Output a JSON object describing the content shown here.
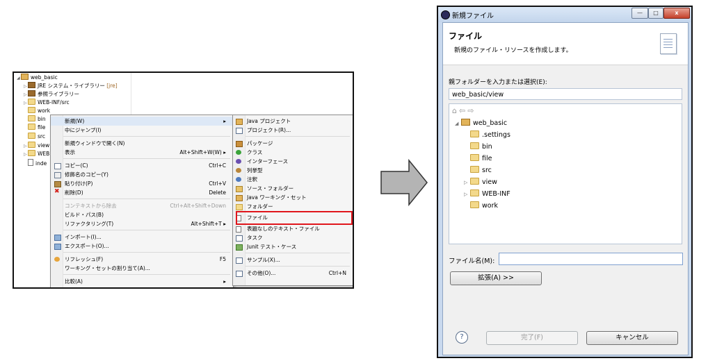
{
  "left": {
    "tree": [
      {
        "label": "web_basic",
        "icon": "project-icon",
        "expanded": true
      },
      {
        "label": "JRE システム・ライブラリー",
        "tag": "[jre]",
        "icon": "library-icon"
      },
      {
        "label": "参照ライブラリー",
        "icon": "library-icon"
      },
      {
        "label": "WEB-INF/src",
        "icon": "source-folder-icon"
      },
      {
        "label": "work",
        "icon": "folder-icon"
      },
      {
        "label": "bin",
        "icon": "folder-icon"
      },
      {
        "label": "file",
        "icon": "folder-icon"
      },
      {
        "label": "src",
        "icon": "folder-icon"
      },
      {
        "label": "view",
        "icon": "folder-icon"
      },
      {
        "label": "WEB",
        "icon": "folder-icon"
      },
      {
        "label": "inde",
        "icon": "file-icon"
      }
    ],
    "menu": [
      {
        "label": "新規(W)",
        "shortcut": "▸"
      },
      {
        "label": "中にジャンプ(I)",
        "shortcut": ""
      },
      {
        "label": "新規ウィンドウで開く(N)",
        "shortcut": ""
      },
      {
        "label": "表示",
        "shortcut": "Alt+Shift+W(W) ▸"
      },
      {
        "label": "コピー(C)",
        "shortcut": "Ctrl+C"
      },
      {
        "label": "修飾名のコピー(Y)",
        "shortcut": ""
      },
      {
        "label": "貼り付け(P)",
        "shortcut": "Ctrl+V"
      },
      {
        "label": "削除(D)",
        "shortcut": "Delete"
      },
      {
        "label": "コンテキストから除去",
        "shortcut": "Ctrl+Alt+Shift+Down"
      },
      {
        "label": "ビルド・パス(B)",
        "shortcut": ""
      },
      {
        "label": "リファクタリング(T)",
        "shortcut": "Alt+Shift+T ▸"
      },
      {
        "label": "インポート(I)...",
        "shortcut": ""
      },
      {
        "label": "エクスポート(O)...",
        "shortcut": ""
      },
      {
        "label": "リフレッシュ(F)",
        "shortcut": "F5"
      },
      {
        "label": "ワーキング・セットの割り当て(A)...",
        "shortcut": ""
      },
      {
        "label": "比較(A)",
        "shortcut": "▸"
      }
    ],
    "submenu": [
      {
        "label": "Java プロジェクト",
        "shortcut": ""
      },
      {
        "label": "プロジェクト(R)...",
        "shortcut": ""
      },
      {
        "label": "パッケージ",
        "shortcut": ""
      },
      {
        "label": "クラス",
        "shortcut": ""
      },
      {
        "label": "インターフェース",
        "shortcut": ""
      },
      {
        "label": "列挙型",
        "shortcut": ""
      },
      {
        "label": "注釈",
        "shortcut": ""
      },
      {
        "label": "ソース・フォルダー",
        "shortcut": ""
      },
      {
        "label": "Java ワーキング・セット",
        "shortcut": ""
      },
      {
        "label": "フォルダー",
        "shortcut": ""
      },
      {
        "label": "ファイル",
        "shortcut": ""
      },
      {
        "label": "表題なしのテキスト・ファイル",
        "shortcut": ""
      },
      {
        "label": "タスク",
        "shortcut": ""
      },
      {
        "label": "Junit テスト・ケース",
        "shortcut": ""
      },
      {
        "label": "サンプル(X)...",
        "shortcut": ""
      },
      {
        "label": "その他(O)...",
        "shortcut": "Ctrl+N"
      }
    ],
    "highlight_color": "#e0151b"
  },
  "dialog": {
    "title": "新規ファイル",
    "window_buttons": {
      "minimize": "—",
      "maximize": "□",
      "close": "x"
    },
    "header_title": "ファイル",
    "header_desc": "新規のファイル・リソースを作成します。",
    "parent_label": "親フォルダーを入力または選択(E):",
    "parent_value": "web_basic/view",
    "tree_toolbar": "⌂⇦⇨",
    "tree": [
      {
        "label": "web_basic",
        "toggle": "◢",
        "icon": "project-icon"
      },
      {
        "label": ".settings",
        "toggle": "",
        "icon": "folder-icon"
      },
      {
        "label": "bin",
        "toggle": "",
        "icon": "folder-icon"
      },
      {
        "label": "file",
        "toggle": "",
        "icon": "folder-icon"
      },
      {
        "label": "src",
        "toggle": "",
        "icon": "folder-icon"
      },
      {
        "label": "view",
        "toggle": "▷",
        "icon": "folder-icon"
      },
      {
        "label": "WEB-INF",
        "toggle": "▷",
        "icon": "folder-icon"
      },
      {
        "label": "work",
        "toggle": "",
        "icon": "folder-icon"
      }
    ],
    "filename_label": "ファイル名(M):",
    "filename_value": "",
    "advanced_label": "拡張(A) >>",
    "help_glyph": "?",
    "finish_label": "完了(F)",
    "cancel_label": "キャンセル"
  }
}
